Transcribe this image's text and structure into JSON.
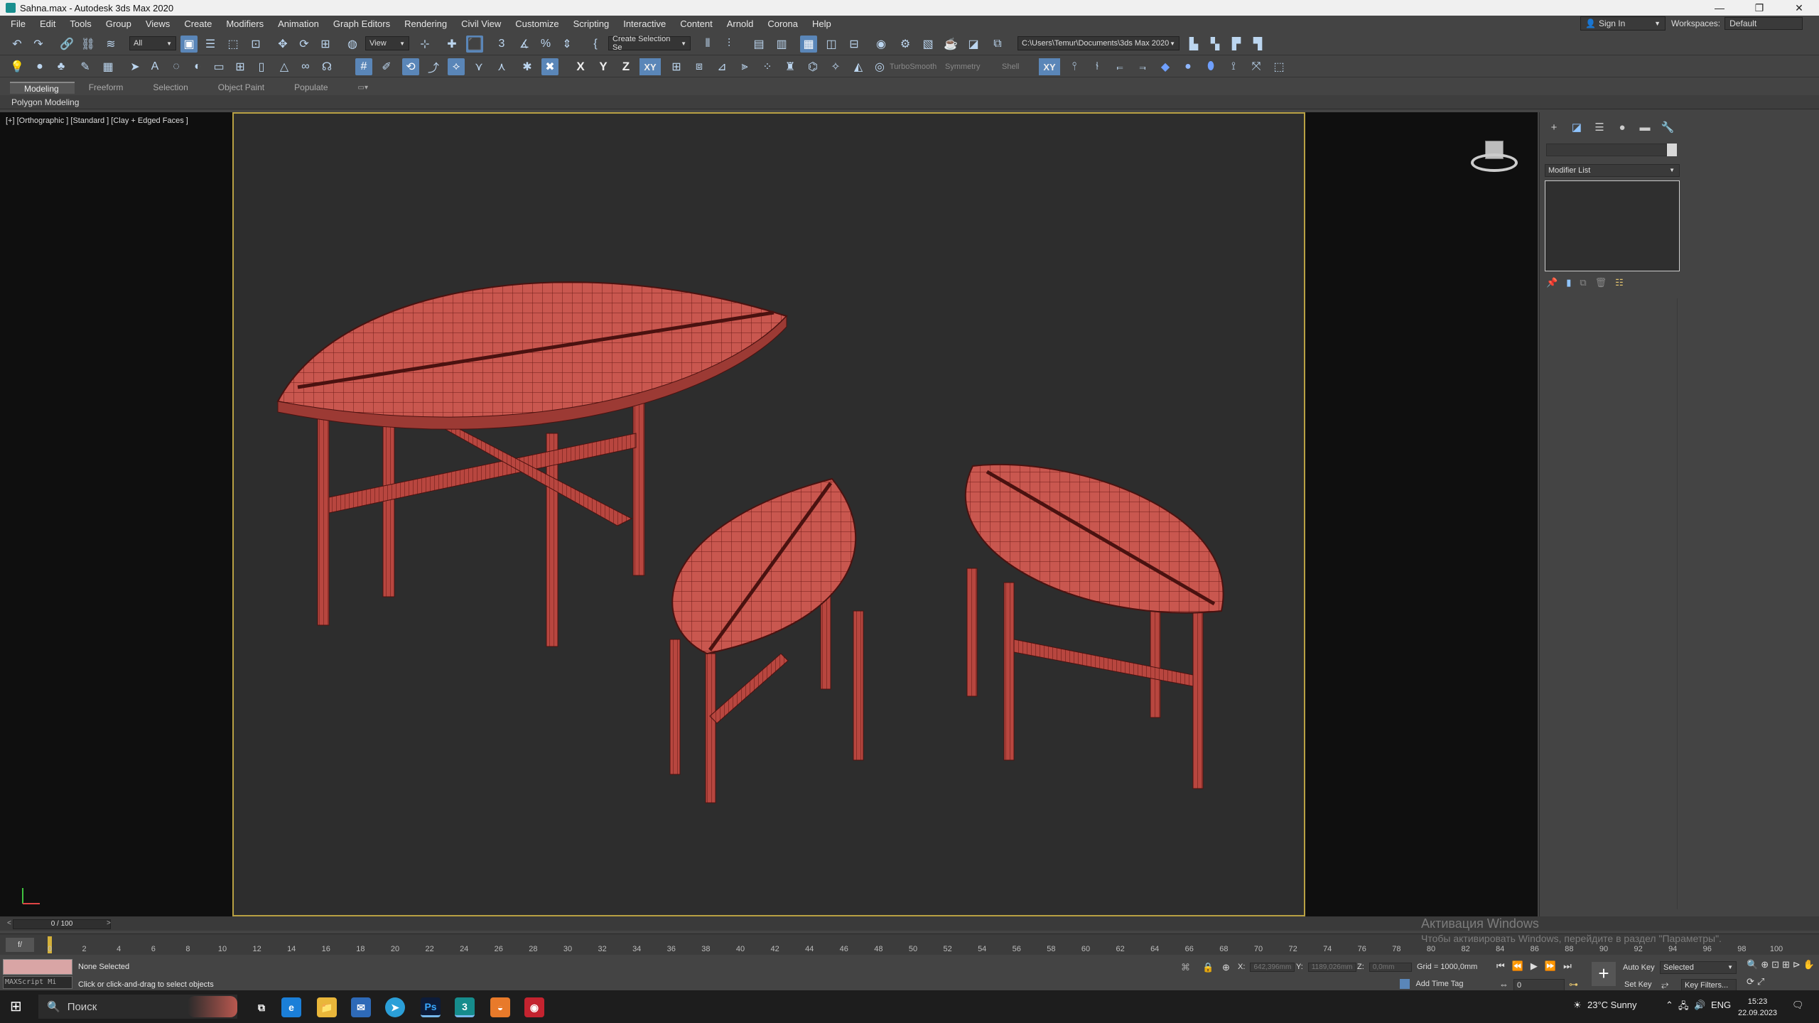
{
  "window": {
    "title": "Sahna.max - Autodesk 3ds Max 2020"
  },
  "window_controls": [
    "—",
    "❐",
    "✕"
  ],
  "menu": [
    "File",
    "Edit",
    "Tools",
    "Group",
    "Views",
    "Create",
    "Modifiers",
    "Animation",
    "Graph Editors",
    "Rendering",
    "Civil View",
    "Customize",
    "Scripting",
    "Interactive",
    "Content",
    "Arnold",
    "Corona",
    "Help"
  ],
  "account": {
    "signin": "Sign In",
    "workspaces_label": "Workspaces:",
    "workspaces_value": "Default"
  },
  "toolbar": {
    "filter": "All",
    "ref_coord": "View",
    "selection_set": "Create Selection Se",
    "project_path": "C:\\Users\\Temur\\Documents\\3ds Max 2020",
    "turbosmooth": "TurboSmooth",
    "symmetry": "Symmetry",
    "shell": "Shell",
    "axis_x": "X",
    "axis_y": "Y",
    "axis_z": "Z",
    "axis_xy": "XY",
    "constraint_xy": "XY"
  },
  "ribbon": {
    "tabs": [
      "Modeling",
      "Freeform",
      "Selection",
      "Object Paint",
      "Populate"
    ],
    "active_panel": "Polygon Modeling"
  },
  "viewport": {
    "label": "[+] [Orthographic ] [Standard ] [Clay + Edged Faces ]"
  },
  "command_panel": {
    "modifier_list": "Modifier List"
  },
  "timeline": {
    "counter": "0 / 100",
    "ticks": [
      "0",
      "2",
      "4",
      "6",
      "8",
      "10",
      "12",
      "14",
      "16",
      "18",
      "20",
      "22",
      "24",
      "26",
      "28",
      "30",
      "32",
      "34",
      "36",
      "38",
      "40",
      "42",
      "44",
      "46",
      "48",
      "50",
      "52",
      "54",
      "56",
      "58",
      "60",
      "62",
      "64",
      "66",
      "68",
      "70",
      "72",
      "74",
      "76",
      "78",
      "80",
      "82",
      "84",
      "86",
      "88",
      "90",
      "92",
      "94",
      "96",
      "98",
      "100"
    ]
  },
  "status": {
    "maxscript": "MAXScript Mi",
    "selection": "None Selected",
    "prompt": "Click or click-and-drag to select objects",
    "x_label": "X:",
    "x_value": "642,396mm",
    "y_label": "Y:",
    "y_value": "1189,026mm",
    "z_label": "Z:",
    "z_value": "0,0mm",
    "grid": "Grid = 1000,0mm",
    "add_time_tag": "Add Time Tag",
    "auto_key": "Auto Key",
    "set_key": "Set Key",
    "selected": "Selected",
    "key_filters": "Key Filters...",
    "frame": "0"
  },
  "activation": {
    "title": "Активация Windows",
    "message": "Чтобы активировать Windows, перейдите в раздел \"Параметры\"."
  },
  "taskbar": {
    "search": "Поиск",
    "weather": "23°C  Sunny",
    "lang": "ENG",
    "time": "15:23",
    "date": "22.09.2023"
  }
}
